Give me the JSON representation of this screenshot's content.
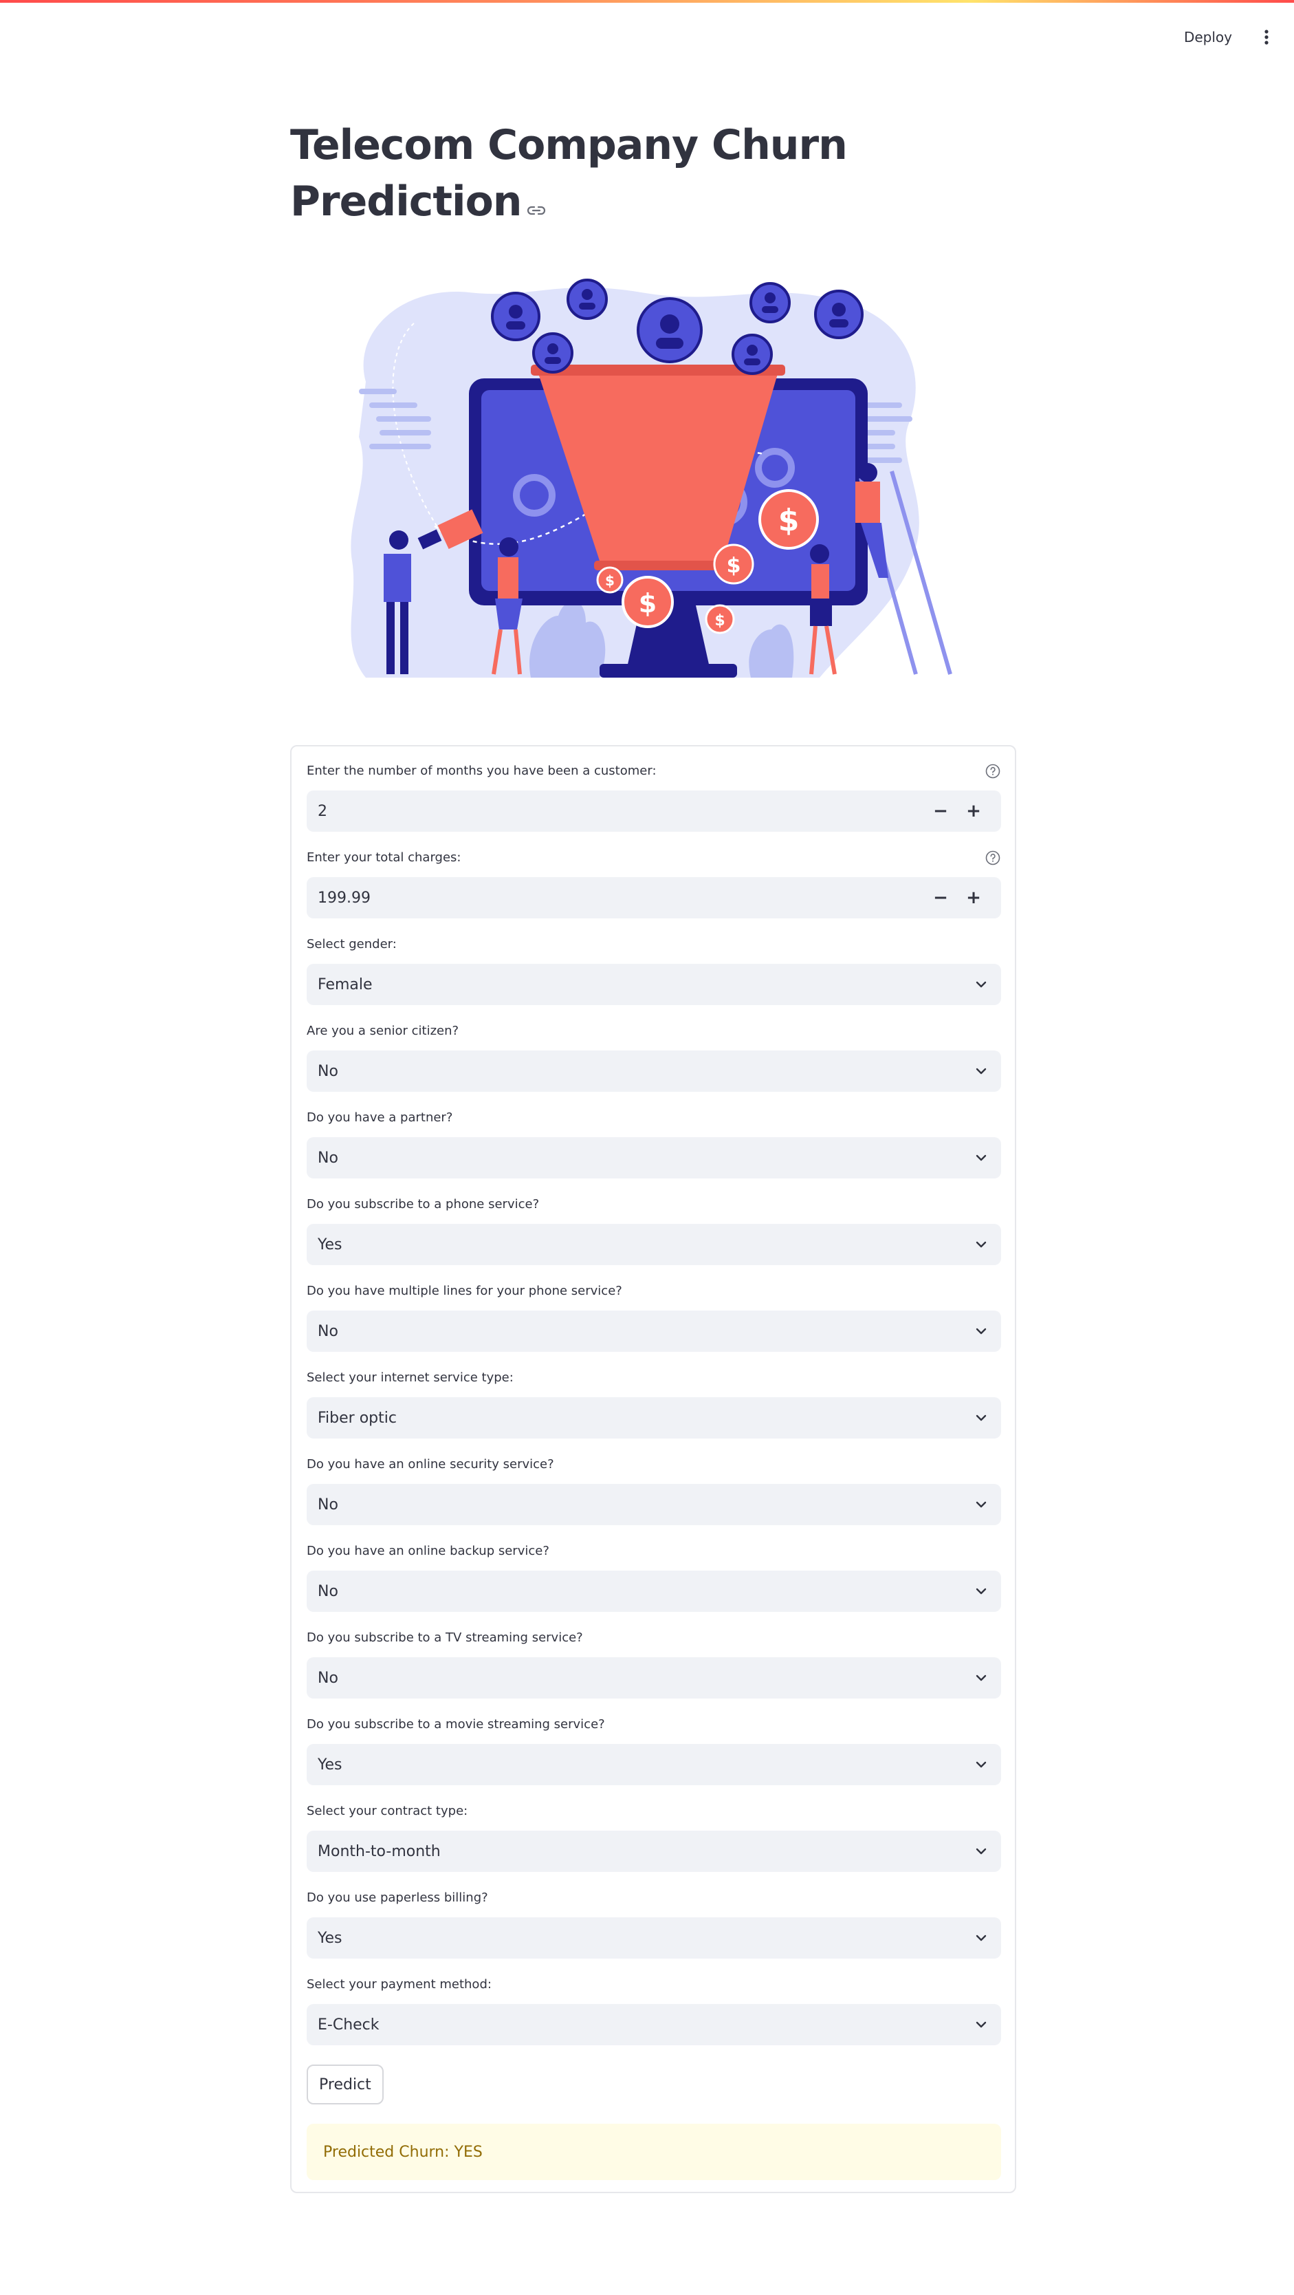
{
  "header": {
    "deploy_label": "Deploy",
    "menu_icon": "vertical-dots-icon"
  },
  "page": {
    "title": "Telecom Company Churn Prediction",
    "anchor_icon": "link-icon"
  },
  "hero": {
    "image_name": "churn-funnel-illustration"
  },
  "form": {
    "tenure": {
      "label": "Enter the number of months you have been a customer:",
      "value": "2",
      "help_icon": "question-circle-icon"
    },
    "total_charges": {
      "label": "Enter your total charges:",
      "value": "199.99",
      "help_icon": "question-circle-icon"
    },
    "gender": {
      "label": "Select gender:",
      "value": "Female"
    },
    "senior": {
      "label": "Are you a senior citizen?",
      "value": "No"
    },
    "partner": {
      "label": "Do you have a partner?",
      "value": "No"
    },
    "phone": {
      "label": "Do you subscribe to a phone service?",
      "value": "Yes"
    },
    "multiple_lines": {
      "label": "Do you have multiple lines for your phone service?",
      "value": "No"
    },
    "internet": {
      "label": "Select your internet service type:",
      "value": "Fiber optic"
    },
    "security": {
      "label": "Do you have an online security service?",
      "value": "No"
    },
    "backup": {
      "label": "Do you have an online backup service?",
      "value": "No"
    },
    "tv": {
      "label": "Do you subscribe to a TV streaming service?",
      "value": "No"
    },
    "movies": {
      "label": "Do you subscribe to a movie streaming service?",
      "value": "Yes"
    },
    "contract": {
      "label": "Select your contract type:",
      "value": "Month-to-month"
    },
    "paperless": {
      "label": "Do you use paperless billing?",
      "value": "Yes"
    },
    "payment": {
      "label": "Select your payment method:",
      "value": "E-Check"
    },
    "predict_label": "Predict",
    "result": "Predicted Churn: YES"
  },
  "colors": {
    "accent": "#ff4b4b",
    "input_bg": "#f0f2f6",
    "alert_bg": "#fffce6",
    "alert_text": "#926c05",
    "illustration_blue": "#4f52d8",
    "illustration_coral": "#f76b5e"
  }
}
